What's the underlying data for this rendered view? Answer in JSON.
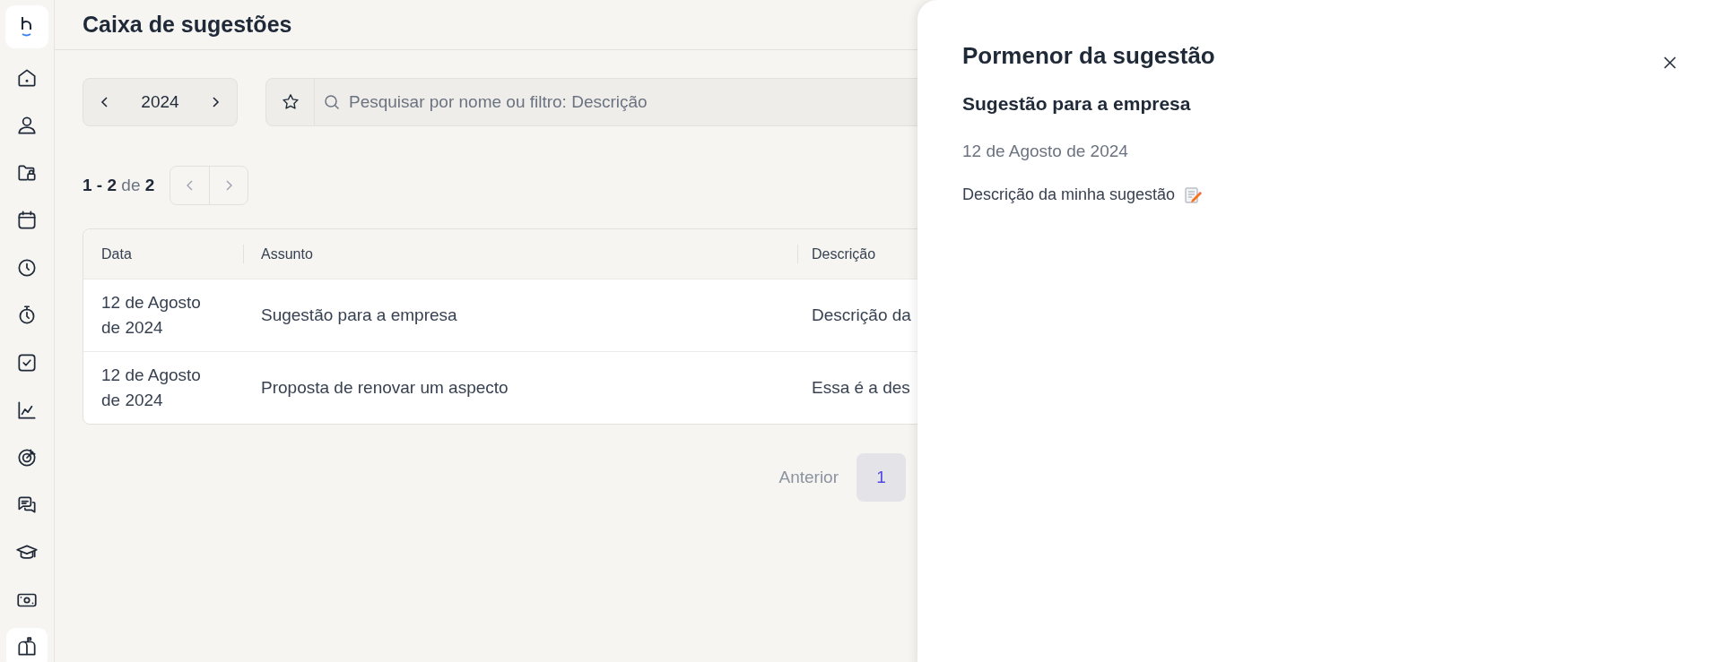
{
  "sidebar": {
    "items": [
      {
        "kind": "home",
        "selected": false
      },
      {
        "kind": "user",
        "selected": false
      },
      {
        "kind": "folder",
        "selected": false
      },
      {
        "kind": "calendar",
        "selected": false
      },
      {
        "kind": "clock",
        "selected": false
      },
      {
        "kind": "stopwatch",
        "selected": false
      },
      {
        "kind": "check",
        "selected": false
      },
      {
        "kind": "chart",
        "selected": false
      },
      {
        "kind": "target",
        "selected": false
      },
      {
        "kind": "chat",
        "selected": false
      },
      {
        "kind": "cap",
        "selected": false
      },
      {
        "kind": "money",
        "selected": false
      },
      {
        "kind": "mailbox",
        "selected": true
      }
    ]
  },
  "page": {
    "title": "Caixa de sugestões"
  },
  "toolbar": {
    "year": "2024",
    "search": {
      "placeholder": "Pesquisar por nome ou filtro: Descrição"
    }
  },
  "range": {
    "text": "**1 - 2** de **2**"
  },
  "table": {
    "columns": [
      "Data",
      "Assunto",
      "Descrição"
    ],
    "rows": [
      {
        "cells": [
          "12 de Agosto de 2024",
          "Sugestão para a empresa",
          "Descrição da"
        ]
      },
      {
        "cells": [
          "12 de Agosto de 2024",
          "Proposta de renovar um aspecto",
          "Essa é a des"
        ]
      }
    ]
  },
  "pagination": {
    "previous": "Anterior",
    "pages": [
      {
        "label": "1",
        "selected": true
      }
    ]
  },
  "detail_panel": {
    "title": "Pormenor da sugestão",
    "subject": "Sugestão para a empresa",
    "date": "12 de Agosto de 2024",
    "description": "Descrição da minha sugestão"
  }
}
